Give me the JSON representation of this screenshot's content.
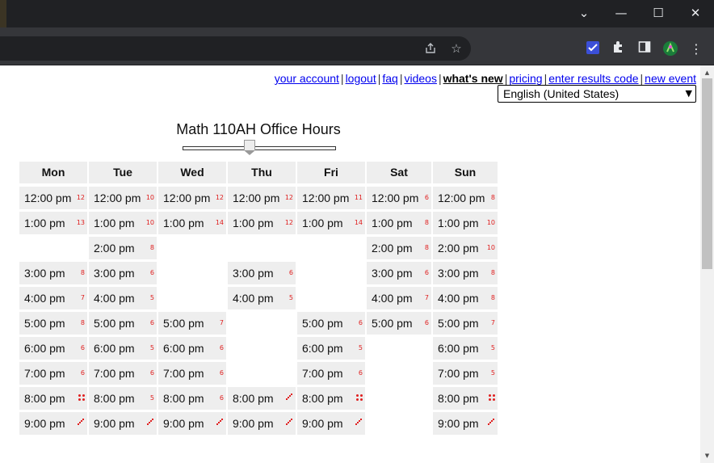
{
  "browser": {
    "window_controls": {
      "minimize": "—",
      "maximize": "☐",
      "close": "✕",
      "tab_search": "⌄"
    },
    "toolbar_icons": [
      "share-icon",
      "bookmark-star-icon",
      "extension-icon",
      "puzzle-icon",
      "sidebar-icon",
      "profile-icon",
      "menu-icon"
    ]
  },
  "nav": {
    "links": [
      "your account",
      "logout",
      "faq",
      "videos",
      "what's new",
      "pricing",
      "enter results code",
      "new event"
    ],
    "separator": "|"
  },
  "language": {
    "selected": "English (United States)"
  },
  "event": {
    "title": "Math 110AH Office Hours"
  },
  "schedule": {
    "days": [
      {
        "name": "Mon",
        "slots": [
          {
            "row": 0,
            "time": "12:00 pm",
            "mark": "12"
          },
          {
            "row": 1,
            "time": "1:00 pm",
            "mark": "13"
          },
          {
            "row": 3,
            "time": "3:00 pm",
            "mark": "8"
          },
          {
            "row": 4,
            "time": "4:00 pm",
            "mark": "7"
          },
          {
            "row": 5,
            "time": "5:00 pm",
            "mark": "8"
          },
          {
            "row": 6,
            "time": "6:00 pm",
            "mark": "6"
          },
          {
            "row": 7,
            "time": "7:00 pm",
            "mark": "6"
          },
          {
            "row": 8,
            "time": "8:00 pm",
            "mark": "dots"
          },
          {
            "row": 9,
            "time": "9:00 pm",
            "mark": "diag"
          }
        ]
      },
      {
        "name": "Tue",
        "slots": [
          {
            "row": 0,
            "time": "12:00 pm",
            "mark": "10"
          },
          {
            "row": 1,
            "time": "1:00 pm",
            "mark": "10"
          },
          {
            "row": 2,
            "time": "2:00 pm",
            "mark": "8"
          },
          {
            "row": 3,
            "time": "3:00 pm",
            "mark": "6"
          },
          {
            "row": 4,
            "time": "4:00 pm",
            "mark": "5"
          },
          {
            "row": 5,
            "time": "5:00 pm",
            "mark": "6"
          },
          {
            "row": 6,
            "time": "6:00 pm",
            "mark": "5"
          },
          {
            "row": 7,
            "time": "7:00 pm",
            "mark": "6"
          },
          {
            "row": 8,
            "time": "8:00 pm",
            "mark": "5"
          },
          {
            "row": 9,
            "time": "9:00 pm",
            "mark": "diag"
          }
        ]
      },
      {
        "name": "Wed",
        "slots": [
          {
            "row": 0,
            "time": "12:00 pm",
            "mark": "12"
          },
          {
            "row": 1,
            "time": "1:00 pm",
            "mark": "14"
          },
          {
            "row": 5,
            "time": "5:00 pm",
            "mark": "7"
          },
          {
            "row": 6,
            "time": "6:00 pm",
            "mark": "6"
          },
          {
            "row": 7,
            "time": "7:00 pm",
            "mark": "6"
          },
          {
            "row": 8,
            "time": "8:00 pm",
            "mark": "6"
          },
          {
            "row": 9,
            "time": "9:00 pm",
            "mark": "diag"
          }
        ]
      },
      {
        "name": "Thu",
        "slots": [
          {
            "row": 0,
            "time": "12:00 pm",
            "mark": "12"
          },
          {
            "row": 1,
            "time": "1:00 pm",
            "mark": "12"
          },
          {
            "row": 3,
            "time": "3:00 pm",
            "mark": "6"
          },
          {
            "row": 4,
            "time": "4:00 pm",
            "mark": "5"
          },
          {
            "row": 8,
            "time": "8:00 pm",
            "mark": "diag"
          },
          {
            "row": 9,
            "time": "9:00 pm",
            "mark": "diag"
          }
        ]
      },
      {
        "name": "Fri",
        "slots": [
          {
            "row": 0,
            "time": "12:00 pm",
            "mark": "11"
          },
          {
            "row": 1,
            "time": "1:00 pm",
            "mark": "14"
          },
          {
            "row": 5,
            "time": "5:00 pm",
            "mark": "6"
          },
          {
            "row": 6,
            "time": "6:00 pm",
            "mark": "5"
          },
          {
            "row": 7,
            "time": "7:00 pm",
            "mark": "6"
          },
          {
            "row": 8,
            "time": "8:00 pm",
            "mark": "dots"
          },
          {
            "row": 9,
            "time": "9:00 pm",
            "mark": "diag"
          }
        ]
      },
      {
        "name": "Sat",
        "slots": [
          {
            "row": 0,
            "time": "12:00 pm",
            "mark": "6"
          },
          {
            "row": 1,
            "time": "1:00 pm",
            "mark": "8"
          },
          {
            "row": 2,
            "time": "2:00 pm",
            "mark": "8"
          },
          {
            "row": 3,
            "time": "3:00 pm",
            "mark": "6"
          },
          {
            "row": 4,
            "time": "4:00 pm",
            "mark": "7"
          },
          {
            "row": 5,
            "time": "5:00 pm",
            "mark": "6"
          }
        ]
      },
      {
        "name": "Sun",
        "slots": [
          {
            "row": 0,
            "time": "12:00 pm",
            "mark": "8"
          },
          {
            "row": 1,
            "time": "1:00 pm",
            "mark": "10"
          },
          {
            "row": 2,
            "time": "2:00 pm",
            "mark": "10"
          },
          {
            "row": 3,
            "time": "3:00 pm",
            "mark": "8"
          },
          {
            "row": 4,
            "time": "4:00 pm",
            "mark": "8"
          },
          {
            "row": 5,
            "time": "5:00 pm",
            "mark": "7"
          },
          {
            "row": 6,
            "time": "6:00 pm",
            "mark": "5"
          },
          {
            "row": 7,
            "time": "7:00 pm",
            "mark": "5"
          },
          {
            "row": 8,
            "time": "8:00 pm",
            "mark": "dots"
          },
          {
            "row": 9,
            "time": "9:00 pm",
            "mark": "diag"
          }
        ]
      }
    ]
  }
}
